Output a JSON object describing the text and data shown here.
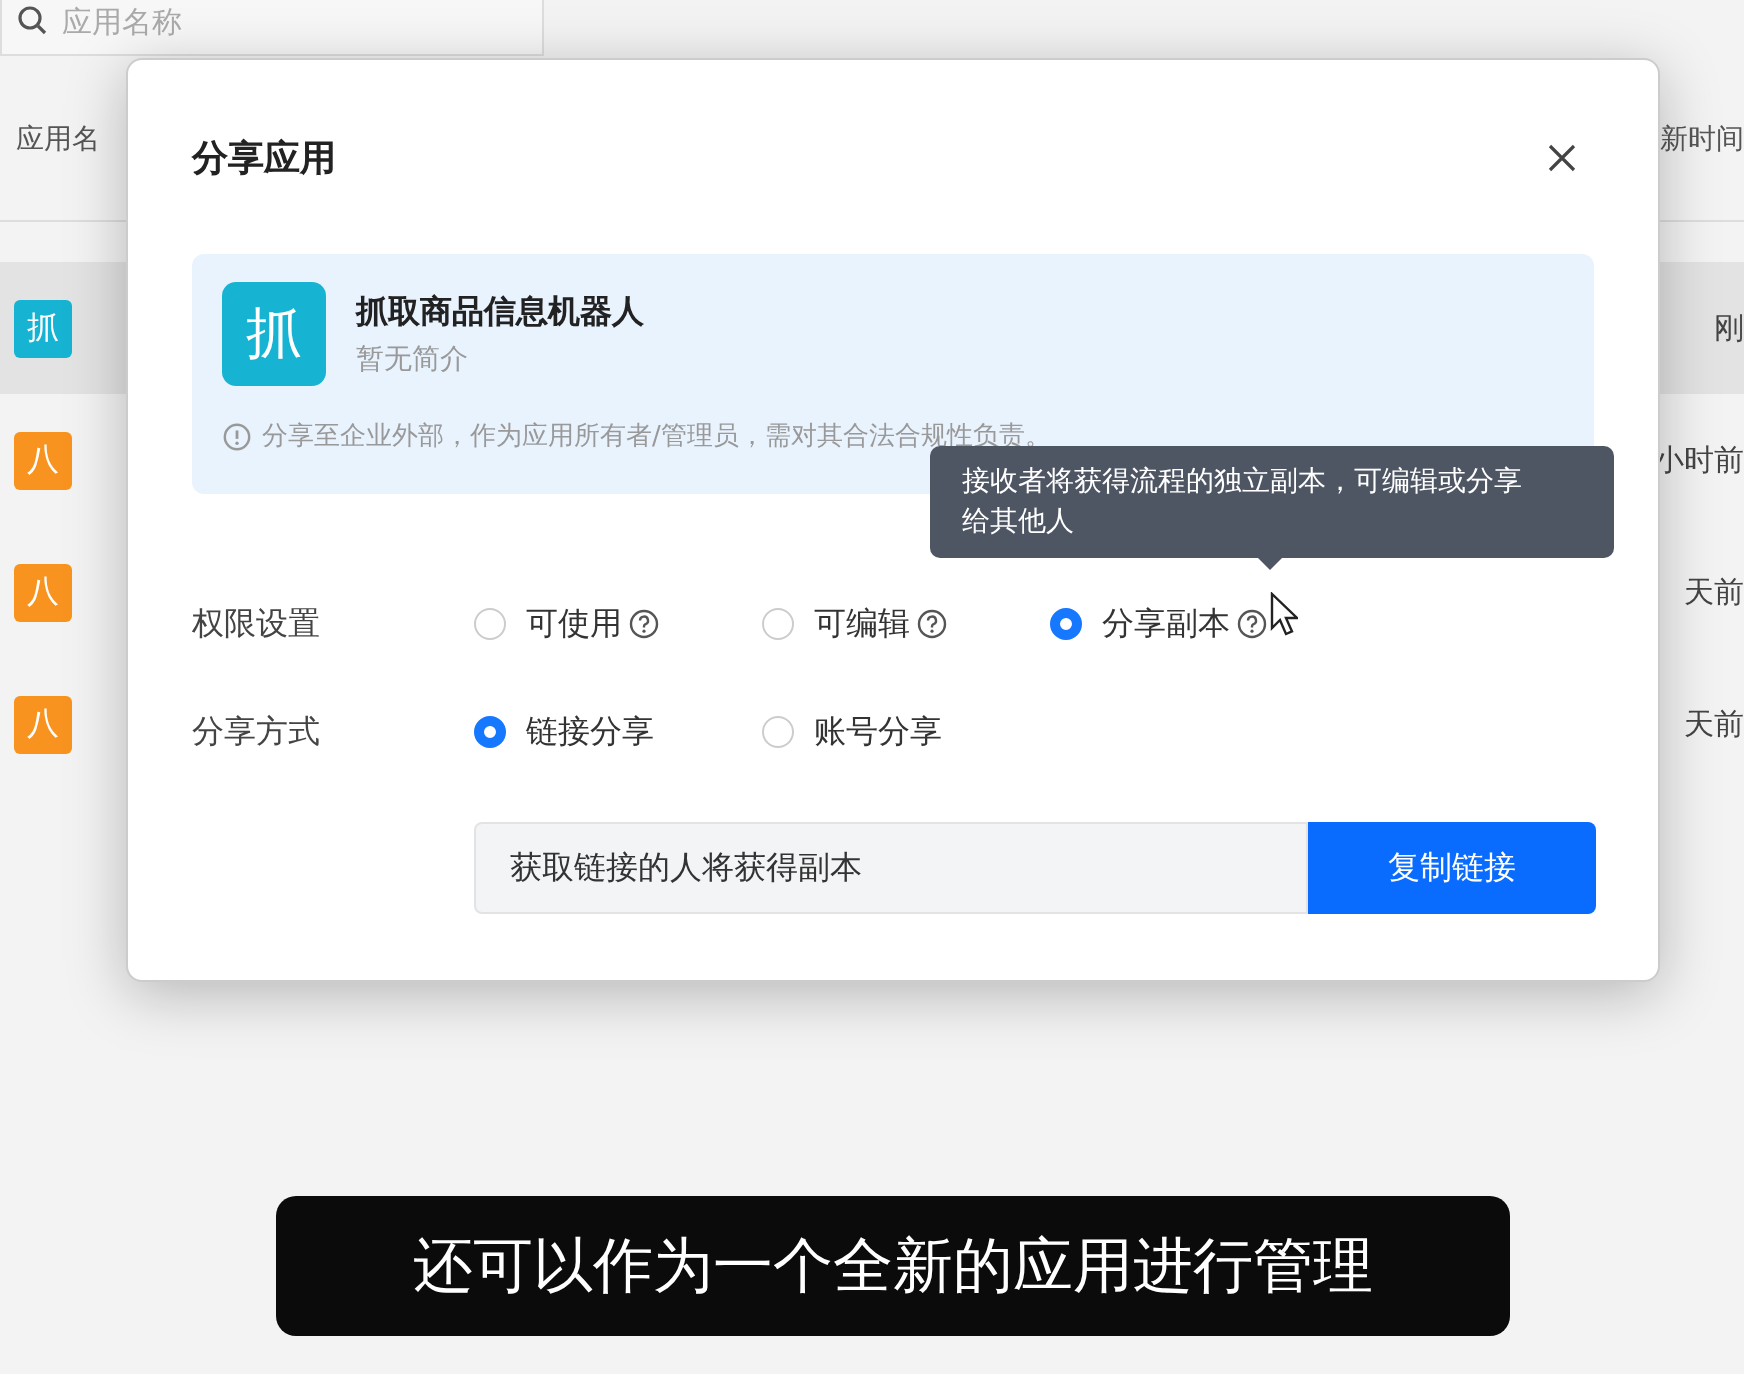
{
  "search": {
    "placeholder": "应用名称"
  },
  "table": {
    "columns": [
      "应用名",
      "新时间"
    ],
    "rows": [
      {
        "icon": "抓",
        "color": "#16b4d2",
        "time": "刚",
        "selected": true
      },
      {
        "icon": "八",
        "color": "#f7931e",
        "time": "小时前",
        "selected": false
      },
      {
        "icon": "八",
        "color": "#f7931e",
        "time": "天前",
        "selected": false
      },
      {
        "icon": "八",
        "color": "#f7931e",
        "time": "天前",
        "selected": false
      }
    ]
  },
  "dialog": {
    "title": "分享应用",
    "app": {
      "icon": "抓",
      "name": "抓取商品信息机器人",
      "description": "暂无简介",
      "notice": "分享至企业外部，作为应用所有者/管理员，需对其合法合规性负责。"
    },
    "tooltip": "接收者将获得流程的独立副本，可编辑或分享给其他人",
    "permission": {
      "label": "权限设置",
      "options": [
        {
          "label": "可使用",
          "selected": false,
          "help": true
        },
        {
          "label": "可编辑",
          "selected": false,
          "help": true
        },
        {
          "label": "分享副本",
          "selected": true,
          "help": true
        }
      ]
    },
    "share_method": {
      "label": "分享方式",
      "options": [
        {
          "label": "链接分享",
          "selected": true,
          "help": false
        },
        {
          "label": "账号分享",
          "selected": false,
          "help": false
        }
      ]
    },
    "link": {
      "value": "获取链接的人将获得副本",
      "button": "复制链接"
    }
  },
  "subtitle": "还可以作为一个全新的应用进行管理"
}
